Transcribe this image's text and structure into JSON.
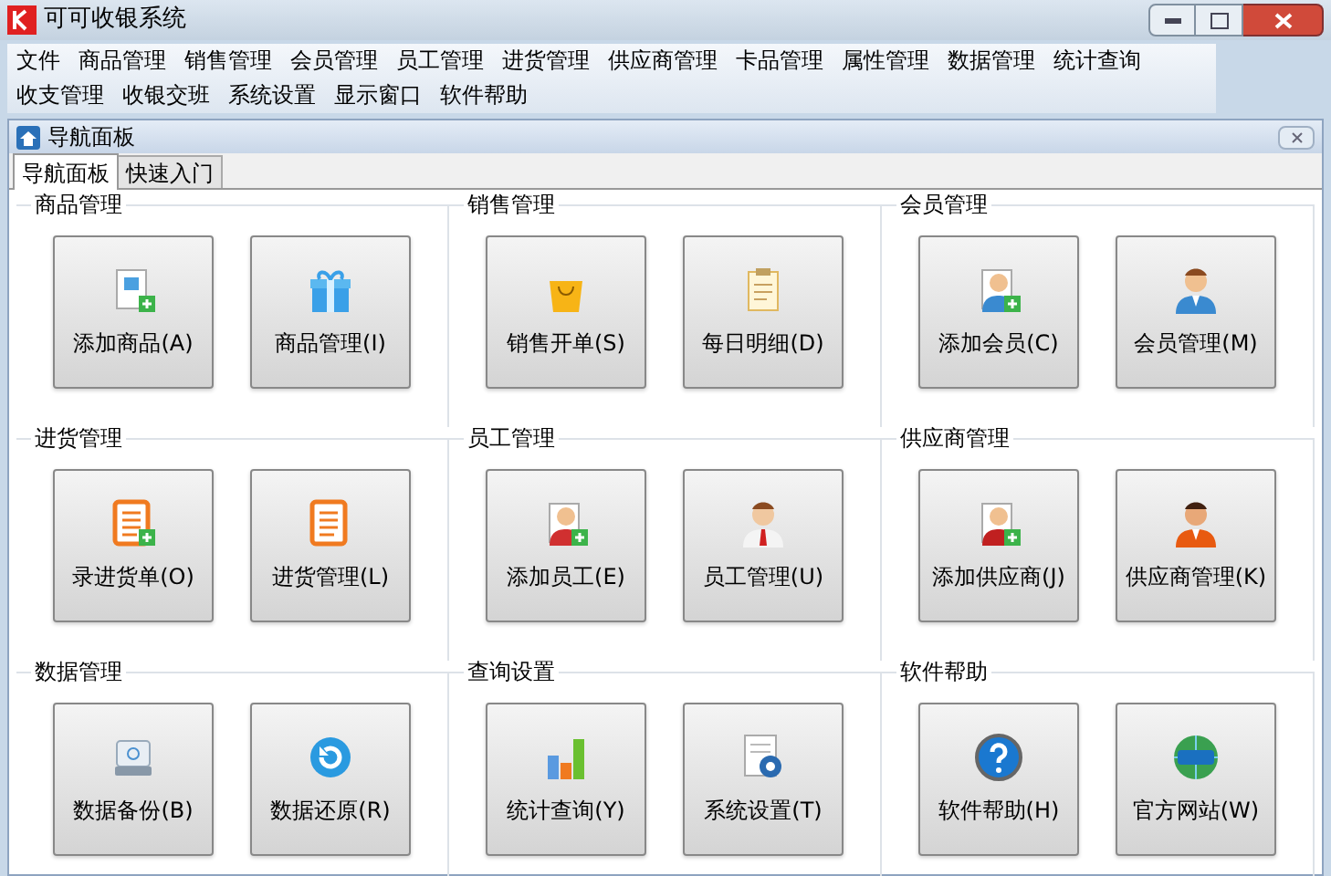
{
  "window": {
    "title": "可可收银系统"
  },
  "menu": [
    "文件",
    "商品管理",
    "销售管理",
    "会员管理",
    "员工管理",
    "进货管理",
    "供应商管理",
    "卡品管理",
    "属性管理",
    "数据管理",
    "统计查询",
    "收支管理",
    "收银交班",
    "系统设置",
    "显示窗口",
    "软件帮助"
  ],
  "panel": {
    "title": "导航面板"
  },
  "tabs": [
    {
      "label": "导航面板",
      "selected": true
    },
    {
      "label": "快速入门",
      "selected": false
    }
  ],
  "groups": [
    {
      "title": "商品管理",
      "buttons": [
        "添加商品(A)",
        "商品管理(I)"
      ]
    },
    {
      "title": "销售管理",
      "buttons": [
        "销售开单(S)",
        "每日明细(D)"
      ]
    },
    {
      "title": "会员管理",
      "buttons": [
        "添加会员(C)",
        "会员管理(M)"
      ]
    },
    {
      "title": "进货管理",
      "buttons": [
        "录进货单(O)",
        "进货管理(L)"
      ]
    },
    {
      "title": "员工管理",
      "buttons": [
        "添加员工(E)",
        "员工管理(U)"
      ]
    },
    {
      "title": "供应商管理",
      "buttons": [
        "添加供应商(J)",
        "供应商管理(K)"
      ]
    },
    {
      "title": "数据管理",
      "buttons": [
        "数据备份(B)",
        "数据还原(R)"
      ]
    },
    {
      "title": "查询设置",
      "buttons": [
        "统计查询(Y)",
        "系统设置(T)"
      ]
    },
    {
      "title": "软件帮助",
      "buttons": [
        "软件帮助(H)",
        "官方网站(W)"
      ]
    }
  ]
}
